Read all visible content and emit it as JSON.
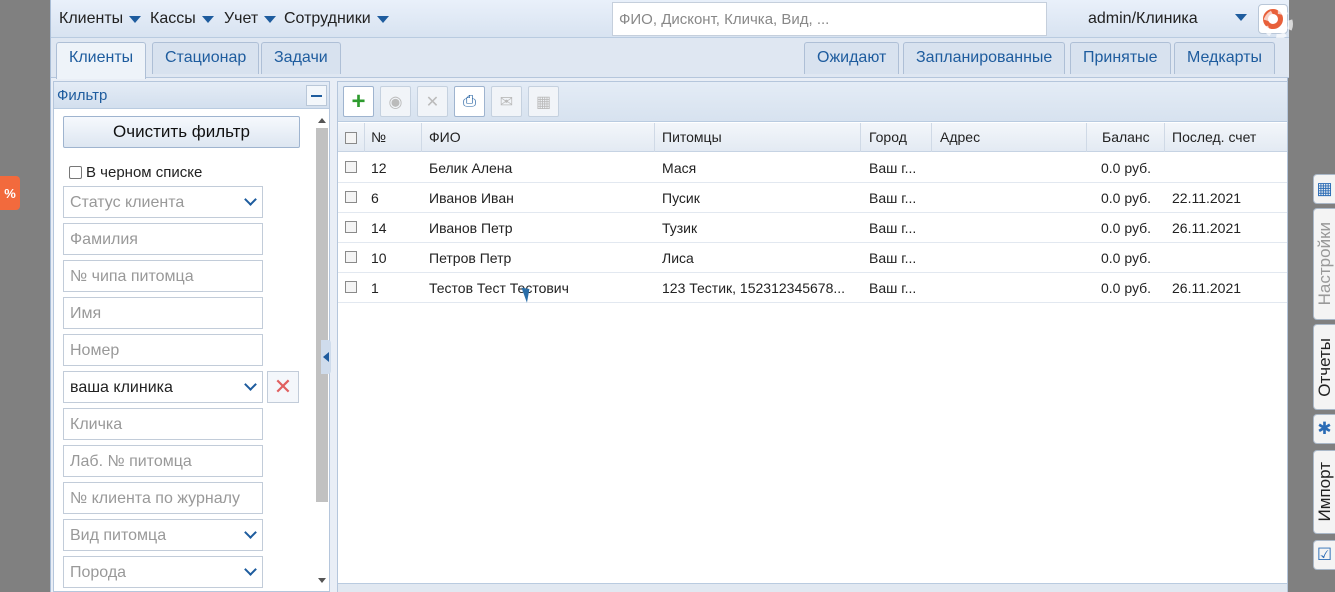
{
  "menu": {
    "items": [
      {
        "label": "Клиенты"
      },
      {
        "label": "Кассы"
      },
      {
        "label": "Учет"
      },
      {
        "label": "Сотрудники"
      }
    ],
    "search_placeholder": "ФИО, Дисконт, Кличка, Вид, ...",
    "user": "admin/Клиника"
  },
  "tabs_left": [
    {
      "label": "Клиенты"
    },
    {
      "label": "Стационар"
    },
    {
      "label": "Задачи"
    }
  ],
  "tabs_right": [
    {
      "label": "Ожидают"
    },
    {
      "label": "Запланированные"
    },
    {
      "label": "Принятые"
    },
    {
      "label": "Медкарты"
    }
  ],
  "filter": {
    "title": "Фильтр",
    "clear_label": "Очистить фильтр",
    "blacklist_label": "В черном списке",
    "fields": [
      {
        "placeholder": "Статус клиента",
        "dropdown": true
      },
      {
        "placeholder": "Фамилия"
      },
      {
        "placeholder": "№ чипа питомца"
      },
      {
        "placeholder": "Имя"
      },
      {
        "placeholder": "Номер"
      },
      {
        "value": "ваша клиника",
        "dropdown": true
      },
      {
        "placeholder": "Кличка"
      },
      {
        "placeholder": "Лаб. № питомца"
      },
      {
        "placeholder": "№ клиента по журналу"
      },
      {
        "placeholder": "Вид питомца",
        "dropdown": true
      },
      {
        "placeholder": "Порода",
        "dropdown": true
      }
    ]
  },
  "table": {
    "columns": [
      "№",
      "ФИО",
      "Питомцы",
      "Город",
      "Адрес",
      "Баланс",
      "Послед. счет"
    ],
    "rows": [
      {
        "num": "12",
        "name": "Белик Алена",
        "pets": "Мася",
        "city": "Ваш г...",
        "address": "",
        "balance": "0.0 руб.",
        "last": ""
      },
      {
        "num": "6",
        "name": "Иванов Иван",
        "pets": "Пусик",
        "city": "Ваш г...",
        "address": "",
        "balance": "0.0 руб.",
        "last": "22.11.2021"
      },
      {
        "num": "14",
        "name": "Иванов Петр",
        "pets": "Тузик",
        "city": "Ваш г...",
        "address": "",
        "balance": "0.0 руб.",
        "last": "26.11.2021"
      },
      {
        "num": "10",
        "name": "Петров Петр",
        "pets": "Лиса",
        "city": "Ваш г...",
        "address": "",
        "balance": "0.0 руб.",
        "last": ""
      },
      {
        "num": "1",
        "name": "Тестов Тест Тестович",
        "pets": "123 Тестик, 152312345678...",
        "city": "Ваш г...",
        "address": "",
        "balance": "0.0 руб.",
        "last": "26.11.2021"
      }
    ]
  },
  "side_tabs": [
    "Настройки",
    "Отчеты",
    "Импорт"
  ],
  "colors": {
    "accent": "#1e5c9e",
    "add": "#2e9b2e",
    "danger": "#e06060",
    "discount_tab": "#f26a3d"
  }
}
